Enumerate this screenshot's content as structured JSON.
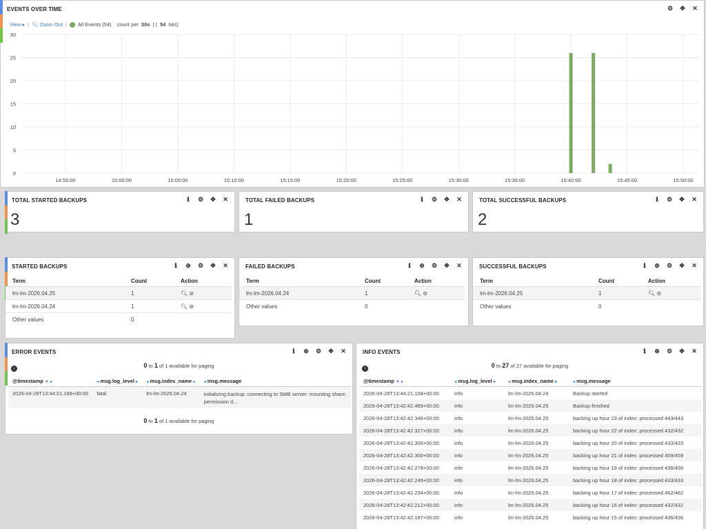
{
  "colors": {
    "strip": [
      "#5b8fe6",
      "#f0944c",
      "#6fc64a"
    ],
    "bar": "#7aab5e",
    "link": "#3a7dd8"
  },
  "events_over_time": {
    "title": "EVENTS OVER TIME",
    "view_label": "View",
    "zoom_label": "Zoom Out",
    "legend_label": "All Events (54)",
    "count_label": "count per",
    "interval": "30s",
    "hits_prefix": "| (",
    "hits": "54",
    "hits_suffix": "hits)"
  },
  "chart_data": {
    "type": "bar",
    "title": "EVENTS OVER TIME",
    "ylim": [
      0,
      30
    ],
    "yticks": [
      "30",
      "25",
      "20",
      "15",
      "10",
      "5",
      "0"
    ],
    "xticks": [
      "14:55:00",
      "15:00:00",
      "15:05:00",
      "15:10:00",
      "15:15:00",
      "15:20:00",
      "15:25:00",
      "15:30:00",
      "15:35:00",
      "15:40:00",
      "15:45:00",
      "15:50:00"
    ],
    "series": [
      {
        "name": "All Events",
        "points": [
          {
            "x": "15:40:00",
            "y": 26
          },
          {
            "x": "15:42:00",
            "y": 26
          },
          {
            "x": "15:43:30",
            "y": 2
          }
        ]
      }
    ],
    "grid": true
  },
  "totals": [
    {
      "title": "TOTAL STARTED BACKUPS",
      "value": "3"
    },
    {
      "title": "TOTAL FAILED BACKUPS",
      "value": "1"
    },
    {
      "title": "TOTAL SUCCESSFUL BACKUPS",
      "value": "2"
    }
  ],
  "terms_headers": {
    "term": "Term",
    "count": "Count",
    "action": "Action"
  },
  "started": {
    "title": "STARTED BACKUPS",
    "rows": [
      {
        "term": "lm-lm-2026.04.25",
        "count": "1"
      },
      {
        "term": "lm-lm-2026.04.24",
        "count": "1"
      }
    ],
    "other": {
      "term": "Other values",
      "count": "0"
    }
  },
  "failed": {
    "title": "FAILED BACKUPS",
    "rows": [
      {
        "term": "lm-lm-2026.04.24",
        "count": "1"
      }
    ],
    "other": {
      "term": "Other values",
      "count": "0"
    }
  },
  "successful": {
    "title": "SUCCESSFUL BACKUPS",
    "rows": [
      {
        "term": "lm-lm-2026.04.25",
        "count": "1"
      }
    ],
    "other": {
      "term": "Other values",
      "count": "0"
    }
  },
  "event_headers": {
    "timestamp": "@timestamp",
    "level": "msg.log_level",
    "index": "msg.index_name",
    "message": "msg.message"
  },
  "error_events": {
    "title": "ERROR EVENTS",
    "paging_from": "0",
    "paging_to_word": "to",
    "paging_to": "1",
    "paging_rest": "of 1 available for paging",
    "rows": [
      {
        "ts": "2026-04-28T13:44:21.168+00:00",
        "level": "fatal",
        "index": "lm-lm-2026.04.24",
        "message": "initializing backup: connecting to SMB server: mounting share:",
        "message2": "permission d..."
      }
    ]
  },
  "info_events": {
    "title": "INFO EVENTS",
    "paging_from": "0",
    "paging_to_word": "to",
    "paging_to": "27",
    "paging_rest": "of 27 available for paging",
    "rows": [
      {
        "ts": "2026-04-28T13:44:21.158+00:00",
        "level": "info",
        "index": "lm-lm-2026.04.24",
        "message": "Backup started"
      },
      {
        "ts": "2026-04-28T13:42:42.469+00:00",
        "level": "info",
        "index": "lm-lm-2026.04.25",
        "message": "Backup finished"
      },
      {
        "ts": "2026-04-28T13:42:42.346+00:00",
        "level": "info",
        "index": "lm-lm-2026.04.25",
        "message": "backing up hour 23 of index: processed 443/443"
      },
      {
        "ts": "2026-04-28T13:42:42.327+00:00",
        "level": "info",
        "index": "lm-lm-2026.04.25",
        "message": "backing up hour 22 of index: processed 432/432"
      },
      {
        "ts": "2026-04-28T13:42:42.306+00:00",
        "level": "info",
        "index": "lm-lm-2026.04.25",
        "message": "backing up hour 20 of index: processed 433/433"
      },
      {
        "ts": "2026-04-28T13:42:42.300+00:00",
        "level": "info",
        "index": "lm-lm-2026.04.25",
        "message": "backing up hour 21 of index: processed 459/459"
      },
      {
        "ts": "2026-04-28T13:42:42.278+00:00",
        "level": "info",
        "index": "lm-lm-2026.04.25",
        "message": "backing up hour 19 of index: processed 436/436"
      },
      {
        "ts": "2026-04-28T13:42:42.249+00:00",
        "level": "info",
        "index": "lm-lm-2026.04.25",
        "message": "backing up hour 18 of index: processed 433/433"
      },
      {
        "ts": "2026-04-28T13:42:42.234+00:00",
        "level": "info",
        "index": "lm-lm-2026.04.25",
        "message": "backing up hour 17 of index: processed 462/462"
      },
      {
        "ts": "2026-04-28T13:42:42.212+00:00",
        "level": "info",
        "index": "lm-lm-2026.04.25",
        "message": "backing up hour 16 of index: processed 432/432"
      },
      {
        "ts": "2026-04-28T13:42:42.187+00:00",
        "level": "info",
        "index": "lm-lm-2026.04.25",
        "message": "backing up hour 15 of index: processed 436/436"
      }
    ]
  }
}
